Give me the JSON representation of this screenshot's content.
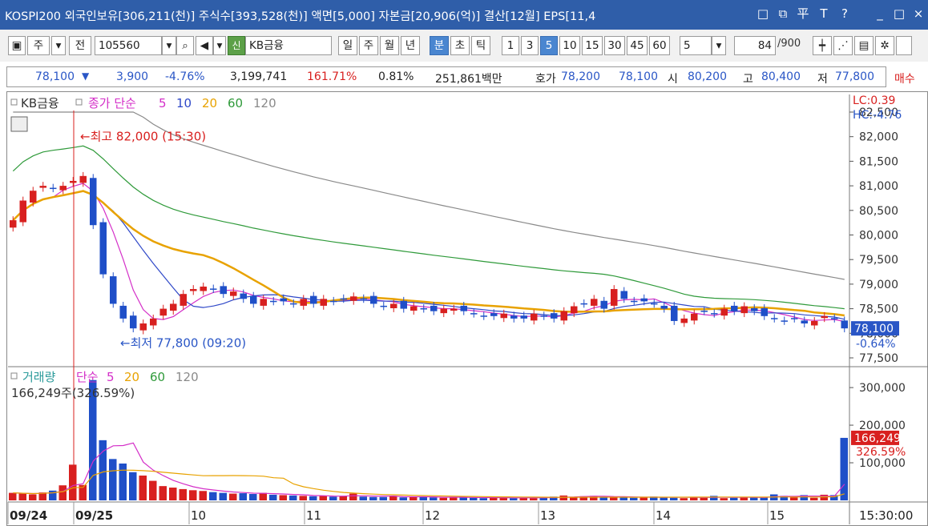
{
  "title": "KOSPI200 외국인보유[306,211(천)] 주식수[393,528(천)] 액면[5,000] 자본금[20,906(억)] 결산[12월] EPS[11,4",
  "window_buttons": {
    "restore": "□",
    "popout": "⧉",
    "pin": "平",
    "font": "T",
    "help": "?",
    "minimize": "_",
    "maximize": "□",
    "close": "×"
  },
  "toolbar": {
    "period_label": "주",
    "prev_label": "전",
    "code": "105560",
    "name": "KB금융",
    "name_badge": "신",
    "tabs": [
      "일",
      "주",
      "월",
      "년",
      "분",
      "초",
      "틱"
    ],
    "active_tab": "분",
    "intervals": [
      "1",
      "3",
      "5",
      "10",
      "15",
      "30",
      "45",
      "60"
    ],
    "active_interval": "5",
    "interval_value": "5",
    "count": "84",
    "count_max": "/900"
  },
  "quote": {
    "price": "78,100",
    "arrow": "▼",
    "change": "3,900",
    "change_pct": "-4.76%",
    "volume": "3,199,741",
    "vol_ratio": "161.71%",
    "turnover": "0.81%",
    "amount": "251,861백만",
    "bid_label": "호가",
    "bid": "78,200",
    "ask": "78,100",
    "open_label": "시",
    "open": "80,200",
    "high_label": "고",
    "high": "80,400",
    "low_label": "저",
    "low": "77,800",
    "sell_button": "매수"
  },
  "price_chart": {
    "legend_name": "KB금융",
    "legend_close": "종가 단순",
    "ma": [
      "5",
      "10",
      "20",
      "60",
      "120"
    ],
    "ma_colors": [
      "#d42fc8",
      "#2f48c8",
      "#e8a200",
      "#2f9a3a",
      "#8a8a8a"
    ],
    "lc": "LC:0.39",
    "hc": "HC:-4.76",
    "hi_note": "최고 82,000 (15:30)",
    "lo_note": "최저 77,800 (09:20)",
    "axis": [
      "82,500",
      "82,000",
      "81,500",
      "81,000",
      "80,500",
      "80,000",
      "79,500",
      "79,000",
      "78,500",
      "78,000",
      "77,500"
    ],
    "current_price": "78,100",
    "current_pct": "-0.64%"
  },
  "volume_chart": {
    "legend": "거래량",
    "ma_label": "단순",
    "ma": [
      "5",
      "20",
      "60",
      "120"
    ],
    "ma_colors": [
      "#d42fc8",
      "#e8a200",
      "#2f9a3a",
      "#8a8a8a"
    ],
    "value_note": "166,249주(326.59%)",
    "axis": [
      "300,000",
      "200,000",
      "100,000"
    ],
    "current": "166,249",
    "current_pct": "326.59%"
  },
  "x_axis": {
    "labels": [
      "09/24",
      "09/25",
      "10",
      "11",
      "12",
      "13",
      "14",
      "15"
    ],
    "time": "15:30:00"
  },
  "chart_data": {
    "type": "candlestick",
    "title": "KB금융",
    "ylim": [
      77500,
      82500
    ],
    "highest": "82,000",
    "lowest": "77,800",
    "close_series": [
      80300,
      80700,
      80900,
      81000,
      80950,
      81000,
      81100,
      81200,
      80200,
      79200,
      78600,
      78300,
      78100,
      78200,
      78300,
      78500,
      78600,
      78800,
      78900,
      78950,
      78900,
      78800,
      78850,
      78700,
      78600,
      78700,
      78650,
      78650,
      78600,
      78700,
      78600,
      78700,
      78650,
      78700,
      78750,
      78700,
      78600,
      78550,
      78600,
      78500,
      78550,
      78500,
      78450,
      78500,
      78500,
      78450,
      78400,
      78350,
      78350,
      78400,
      78300,
      78300,
      78400,
      78350,
      78300,
      78450,
      78550,
      78600,
      78700,
      78500,
      78900,
      78700,
      78650,
      78650,
      78600,
      78500,
      78250,
      78300,
      78400,
      78450,
      78400,
      78500,
      78450,
      78550,
      78450,
      78350,
      78300,
      78250,
      78300,
      78200,
      78250,
      78350,
      78300,
      78100
    ],
    "volume_series": [
      20000,
      18000,
      16000,
      21000,
      26000,
      40000,
      95000,
      41000,
      320000,
      160000,
      110000,
      98000,
      75000,
      66000,
      52000,
      38000,
      34000,
      30000,
      27000,
      25000,
      22000,
      20000,
      18000,
      19000,
      17000,
      20000,
      15000,
      14000,
      13000,
      12000,
      11000,
      12000,
      10000,
      11000,
      18000,
      10000,
      9000,
      9000,
      12000,
      8000,
      10000,
      9000,
      8000,
      7000,
      9000,
      8000,
      7000,
      6000,
      7000,
      8000,
      6000,
      7000,
      6000,
      8000,
      10000,
      13000,
      9000,
      11000,
      12000,
      10000,
      9000,
      8000,
      7000,
      9000,
      10000,
      8000,
      7000,
      6000,
      9000,
      8000,
      12000,
      6000,
      7000,
      8000,
      9000,
      8000,
      16000,
      12000,
      8000,
      14000,
      7000,
      15000,
      14000,
      166249
    ]
  }
}
